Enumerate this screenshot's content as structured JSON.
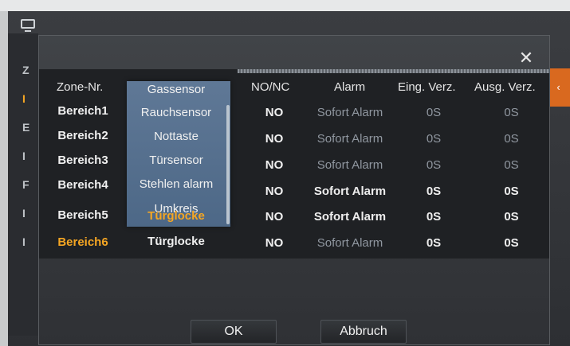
{
  "background_menu": {
    "letters": [
      "Z",
      "I",
      "E",
      "I",
      "F",
      "I",
      "I"
    ],
    "right_peek_text": "‹"
  },
  "dialog": {
    "close_label": "✕",
    "columns": {
      "zone": "Zone-Nr.",
      "nonc": "NO/NC",
      "alarm": "Alarm",
      "eing": "Eing. Verz.",
      "ausg": "Ausg. Verz."
    },
    "rows": [
      {
        "zone": "Bereich1",
        "nonc": "NO",
        "alarm": "Sofort Alarm",
        "eing": "0S",
        "ausg": "0S"
      },
      {
        "zone": "Bereich2",
        "nonc": "NO",
        "alarm": "Sofort Alarm",
        "eing": "0S",
        "ausg": "0S"
      },
      {
        "zone": "Bereich3",
        "nonc": "NO",
        "alarm": "Sofort Alarm",
        "eing": "0S",
        "ausg": "0S"
      },
      {
        "zone": "Bereich4",
        "nonc": "NO",
        "alarm": "Sofort Alarm",
        "eing": "0S",
        "ausg": "0S"
      },
      {
        "zone": "Bereich5",
        "nonc": "NO",
        "alarm": "Sofort Alarm",
        "eing": "0S",
        "ausg": "0S"
      },
      {
        "zone": "Bereich6",
        "nonc": "NO",
        "alarm": "Sofort Alarm",
        "eing": "0S",
        "ausg": "0S"
      }
    ],
    "selected_zone": "Bereich6",
    "zone_type_value": "Türglocke",
    "zone_type_dropdown": {
      "options": [
        "Gassensor",
        "Rauchsensor",
        "Nottaste",
        "Türsensor",
        "Stehlen alarm",
        "Umkreis",
        "Türglocke"
      ],
      "highlighted": "Türglocke"
    },
    "buttons": {
      "ok": "OK",
      "cancel": "Abbruch"
    }
  },
  "colors": {
    "highlight": "#f5a623",
    "dropdown_bg": "#587392",
    "tab_accent": "#d9691f"
  }
}
